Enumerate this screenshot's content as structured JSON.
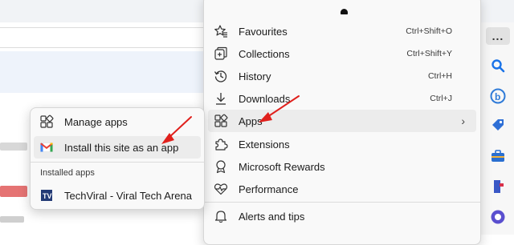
{
  "main_menu": {
    "items": [
      {
        "label": "Favourites",
        "shortcut": "Ctrl+Shift+O"
      },
      {
        "label": "Collections",
        "shortcut": "Ctrl+Shift+Y"
      },
      {
        "label": "History",
        "shortcut": "Ctrl+H"
      },
      {
        "label": "Downloads",
        "shortcut": "Ctrl+J"
      },
      {
        "label": "Apps",
        "shortcut": ""
      },
      {
        "label": "Extensions",
        "shortcut": ""
      },
      {
        "label": "Microsoft Rewards",
        "shortcut": ""
      },
      {
        "label": "Performance",
        "shortcut": ""
      },
      {
        "label": "Alerts and tips",
        "shortcut": ""
      }
    ]
  },
  "apps_submenu": {
    "manage_label": "Manage apps",
    "install_label": "Install this site as an app",
    "installed_heading": "Installed apps",
    "installed_apps": [
      {
        "label": "TechViral - Viral Tech Arena"
      }
    ]
  },
  "toolbar": {
    "more_label": "..."
  },
  "colors": {
    "accent_blue": "#1a73e8",
    "annotation_red": "#e0201c",
    "menu_background": "#f9f9f9",
    "hover_background": "#ececec"
  },
  "icons": [
    "favourites-icon",
    "collections-icon",
    "history-icon",
    "downloads-icon",
    "apps-icon",
    "extensions-icon",
    "rewards-icon",
    "performance-icon",
    "alerts-icon",
    "search-icon",
    "bing-icon",
    "tag-icon",
    "toolbox-icon",
    "games-icon",
    "outlook-icon",
    "gmail-icon",
    "techviral-icon",
    "manage-apps-icon"
  ]
}
